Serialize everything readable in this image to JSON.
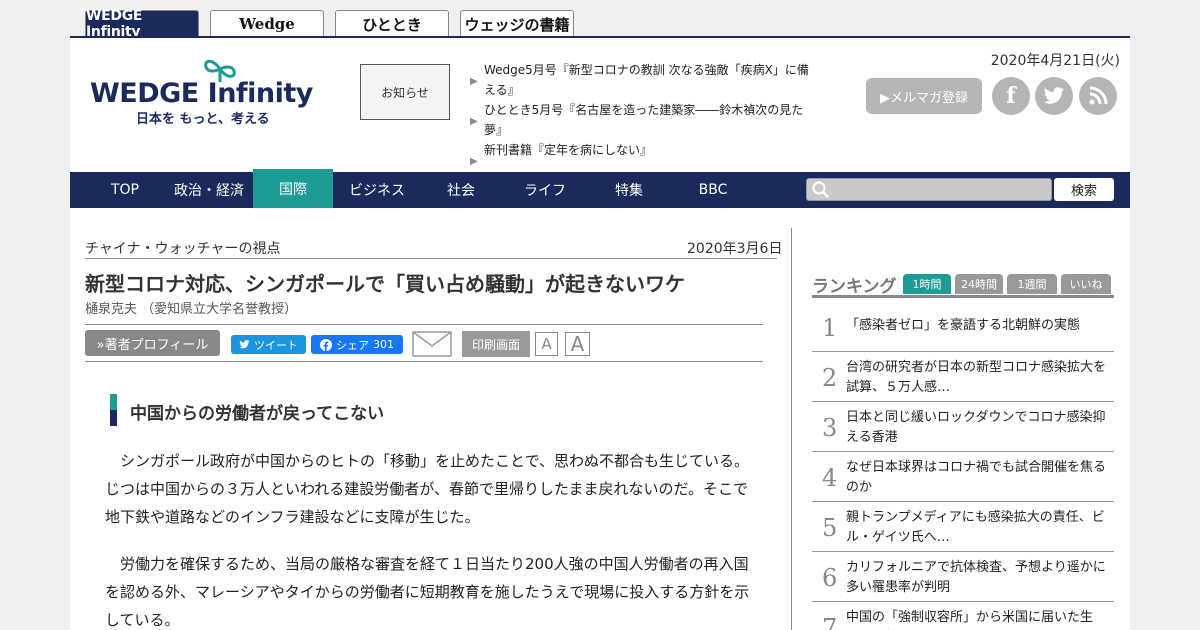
{
  "site_tabs": [
    {
      "label": "WEDGE Infinity"
    },
    {
      "label": "Wedge"
    },
    {
      "label": "ひととき"
    },
    {
      "label": "ウェッジの書籍"
    }
  ],
  "header": {
    "logo_text": "WEDGE Infinity",
    "logo_tagline": "日本を もっと、考える",
    "notice_label": "お知らせ",
    "news": [
      "Wedge5月号『新型コロナの教訓 次なる強敵「疾病X」に備える』",
      "ひととき5月号『名古屋を造った建築家――鈴木禎次の見た夢』",
      "新刊書籍『定年を病にしない』"
    ],
    "date": "2020年4月21日(火)",
    "mailmag_label": "▶メルマガ登録"
  },
  "nav": {
    "items": [
      "TOP",
      "政治・経済",
      "国際",
      "ビジネス",
      "社会",
      "ライフ",
      "特集",
      "BBC"
    ],
    "active": "国際",
    "search_placeholder": "",
    "search_button": "検索"
  },
  "article": {
    "series": "チャイナ・ウォッチャーの視点",
    "date": "2020年3月6日",
    "title": "新型コロナ対応、シンガポールで「買い占め騒動」が起きないワケ",
    "author": "樋泉克夫 （愛知県立大学名誉教授）",
    "profile_button": "»著者プロフィール",
    "tweet_label": "ツイート",
    "share_label": "シェア",
    "share_count": "301",
    "print_label": "印刷画面",
    "font_small": "A",
    "font_large": "A",
    "subheading": "中国からの労働者が戻ってこない",
    "paragraphs": [
      "シンガポール政府が中国からのヒトの「移動」を止めたことで、思わぬ不都合も生じている。じつは中国からの３万人といわれる建設労働者が、春節で里帰りしたまま戻れないのだ。そこで地下鉄や道路などのインフラ建設などに支障が生じた。",
      "労働力を確保するため、当局の厳格な審査を経て１日当たり200人強の中国人労働者の再入国を認める外、マレーシアやタイからの労働者に短期教育を施したうえで現場に投入する方針を示している。"
    ]
  },
  "ranking": {
    "title": "ランキング",
    "tabs": [
      "1時間",
      "24時間",
      "1週間",
      "いいね"
    ],
    "active_tab": "1時間",
    "items": [
      {
        "rank": "1",
        "text": "「感染者ゼロ」を豪語する北朝鮮の実態"
      },
      {
        "rank": "2",
        "text": "台湾の研究者が日本の新型コロナ感染拡大を試算、５万人感…"
      },
      {
        "rank": "3",
        "text": "日本と同じ緩いロックダウンでコロナ感染抑える香港"
      },
      {
        "rank": "4",
        "text": "なぜ日本球界はコロナ禍でも試合開催を焦るのか"
      },
      {
        "rank": "5",
        "text": "親トランプメディアにも感染拡大の責任、ビル・ゲイツ氏へ…"
      },
      {
        "rank": "6",
        "text": "カリフォルニアで抗体検査、予想より遥かに多い罹患率が判明"
      },
      {
        "rank": "7",
        "text": "中国の「強制収容所」から米国に届いた生還…手紙"
      }
    ]
  },
  "colors": {
    "navy": "#1a2a5c",
    "teal": "#1e9b96",
    "twitter": "#1b95e0",
    "facebook": "#1877f2"
  }
}
